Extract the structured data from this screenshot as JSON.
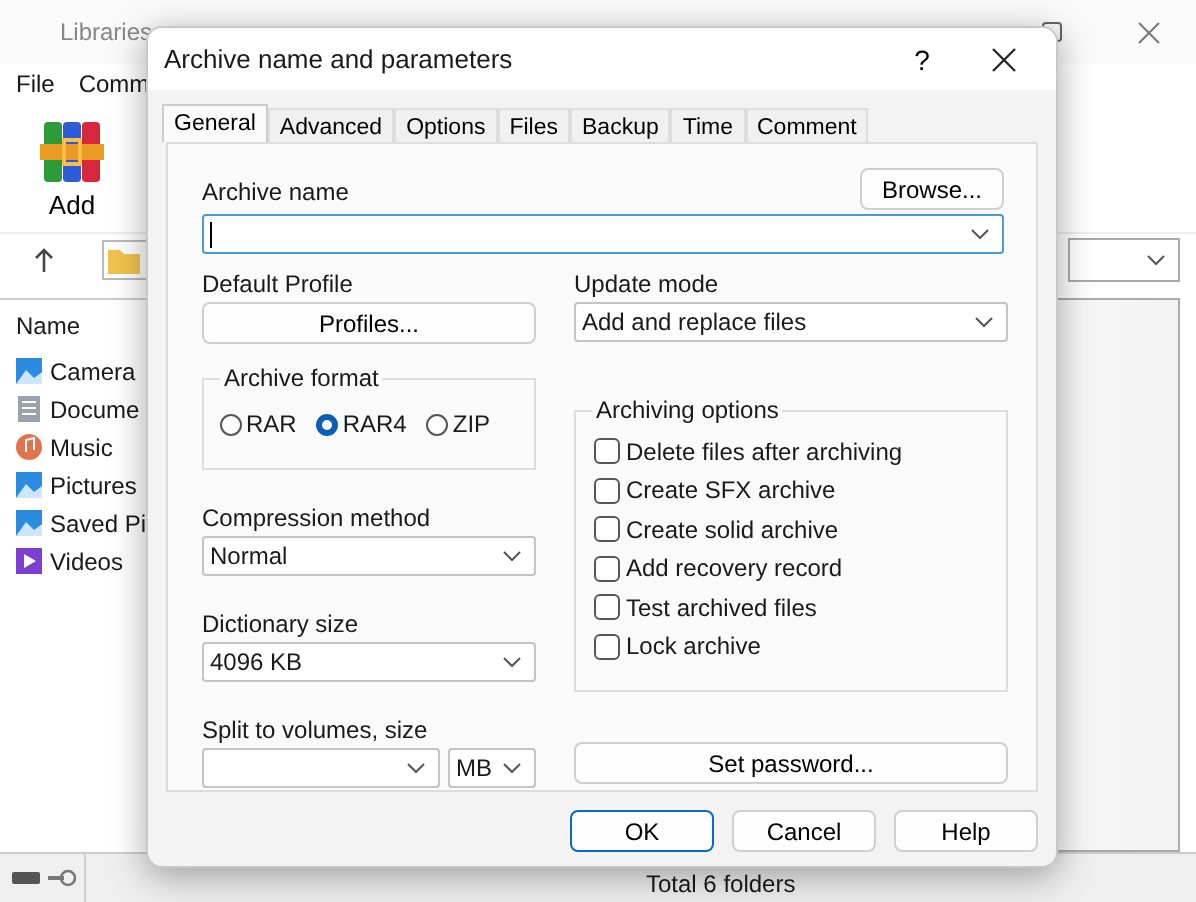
{
  "main_window": {
    "title": "Libraries",
    "menu": [
      "File",
      "Comm"
    ],
    "toolbar": [
      {
        "label": "Add"
      }
    ],
    "column_header": "Name",
    "items": [
      {
        "name": "Camera",
        "kind": "pictures"
      },
      {
        "name": "Docume",
        "kind": "documents"
      },
      {
        "name": "Music",
        "kind": "music"
      },
      {
        "name": "Pictures",
        "kind": "pictures"
      },
      {
        "name": "Saved Pi",
        "kind": "pictures"
      },
      {
        "name": "Videos",
        "kind": "videos"
      }
    ],
    "status": "Total 6 folders"
  },
  "dialog": {
    "title": "Archive name and parameters",
    "help": "?",
    "tabs": [
      {
        "label": "General",
        "selected": true
      },
      {
        "label": "Advanced",
        "selected": false
      },
      {
        "label": "Options",
        "selected": false
      },
      {
        "label": "Files",
        "selected": false
      },
      {
        "label": "Backup",
        "selected": false
      },
      {
        "label": "Time",
        "selected": false
      },
      {
        "label": "Comment",
        "selected": false
      }
    ],
    "archive_name": {
      "label": "Archive name",
      "browse": "Browse..."
    },
    "default_profile": {
      "label": "Default Profile",
      "button": "Profiles..."
    },
    "update_mode": {
      "label": "Update mode",
      "value": "Add and replace files"
    },
    "archive_format": {
      "label": "Archive format",
      "options": [
        {
          "label": "RAR",
          "selected": false
        },
        {
          "label": "RAR4",
          "selected": true
        },
        {
          "label": "ZIP",
          "selected": false
        }
      ]
    },
    "compression_method": {
      "label": "Compression method",
      "value": "Normal"
    },
    "dictionary_size": {
      "label": "Dictionary size",
      "value": "4096 KB"
    },
    "split_volumes": {
      "label": "Split to volumes, size",
      "unit": "MB"
    },
    "archiving_options": {
      "label": "Archiving options",
      "options": [
        {
          "label": "Delete files after archiving",
          "checked": false
        },
        {
          "label": "Create SFX archive",
          "checked": false
        },
        {
          "label": "Create solid archive",
          "checked": false
        },
        {
          "label": "Add recovery record",
          "checked": false
        },
        {
          "label": "Test archived files",
          "checked": false
        },
        {
          "label": "Lock archive",
          "checked": false
        }
      ]
    },
    "set_password": "Set password...",
    "buttons": [
      {
        "label": "OK",
        "default": true
      },
      {
        "label": "Cancel",
        "default": false
      },
      {
        "label": "Help",
        "default": false
      }
    ]
  }
}
